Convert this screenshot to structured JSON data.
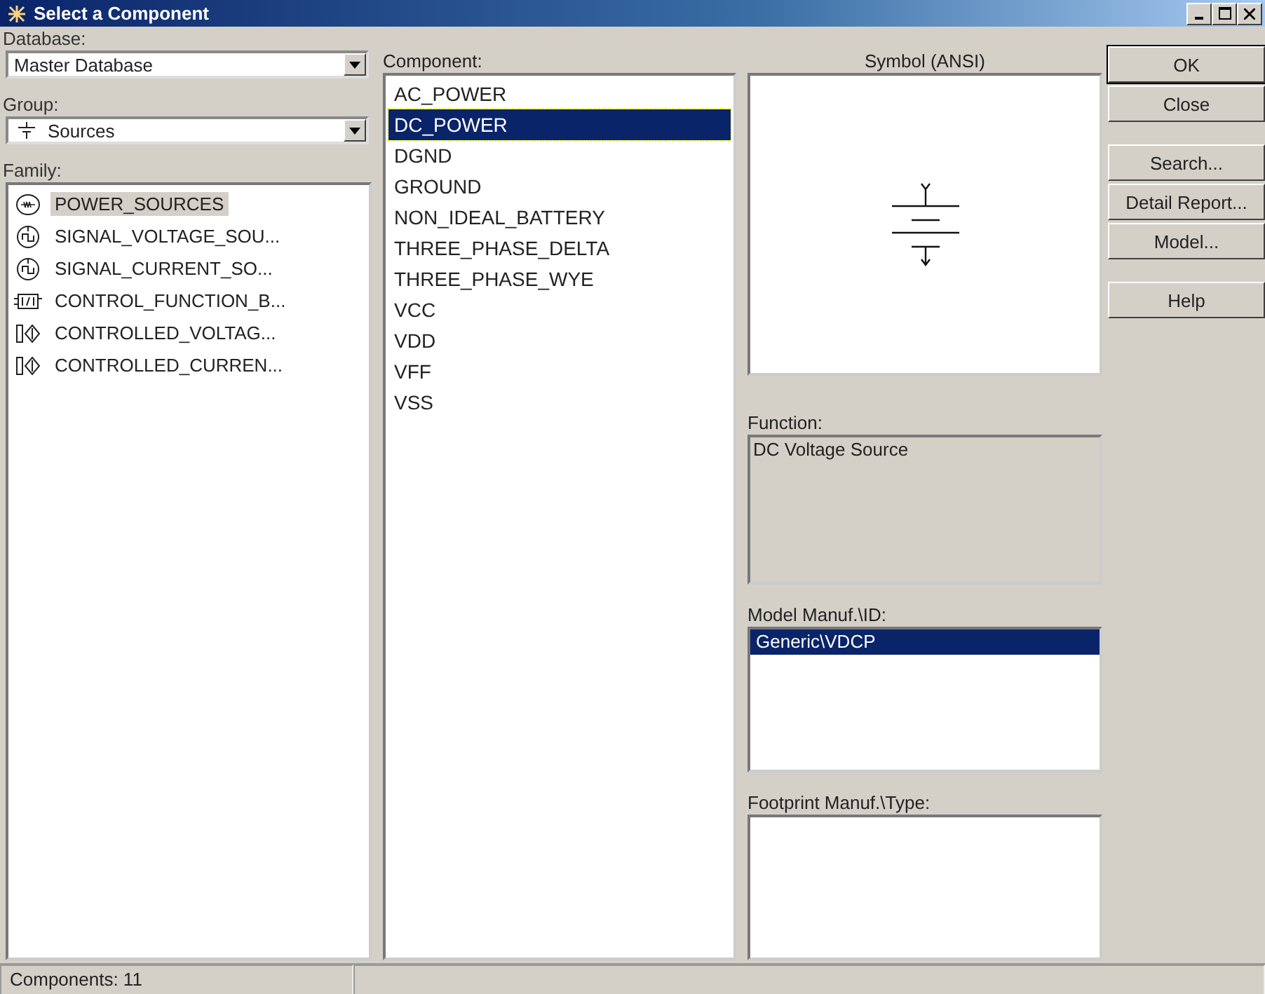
{
  "window": {
    "title": "Select a Component"
  },
  "database": {
    "label": "Database:",
    "value": "Master Database"
  },
  "group": {
    "label": "Group:",
    "value": "Sources"
  },
  "family": {
    "label": "Family:",
    "items": [
      {
        "label": "POWER_SOURCES",
        "selected": true
      },
      {
        "label": "SIGNAL_VOLTAGE_SOU...",
        "selected": false
      },
      {
        "label": "SIGNAL_CURRENT_SO...",
        "selected": false
      },
      {
        "label": "CONTROL_FUNCTION_B...",
        "selected": false
      },
      {
        "label": "CONTROLLED_VOLTAG...",
        "selected": false
      },
      {
        "label": "CONTROLLED_CURREN...",
        "selected": false
      }
    ]
  },
  "component": {
    "label": "Component:",
    "items": [
      {
        "label": "AC_POWER",
        "selected": false
      },
      {
        "label": "DC_POWER",
        "selected": true
      },
      {
        "label": "DGND",
        "selected": false
      },
      {
        "label": "GROUND",
        "selected": false
      },
      {
        "label": "NON_IDEAL_BATTERY",
        "selected": false
      },
      {
        "label": "THREE_PHASE_DELTA",
        "selected": false
      },
      {
        "label": "THREE_PHASE_WYE",
        "selected": false
      },
      {
        "label": "VCC",
        "selected": false
      },
      {
        "label": "VDD",
        "selected": false
      },
      {
        "label": "VFF",
        "selected": false
      },
      {
        "label": "VSS",
        "selected": false
      }
    ]
  },
  "symbol": {
    "label": "Symbol (ANSI)"
  },
  "function": {
    "label": "Function:",
    "value": "DC Voltage Source"
  },
  "model": {
    "label": "Model Manuf.\\ID:",
    "items": [
      {
        "label": "Generic\\VDCP",
        "selected": true
      }
    ]
  },
  "footprint": {
    "label": "Footprint Manuf.\\Type:"
  },
  "buttons": [
    {
      "label": "OK",
      "kind": "default"
    },
    {
      "label": "Close",
      "kind": "normal"
    },
    {
      "label": "Search...",
      "kind": "spaced"
    },
    {
      "label": "Detail Report...",
      "kind": "normal"
    },
    {
      "label": "Model...",
      "kind": "normal"
    },
    {
      "label": "Help",
      "kind": "spaced"
    }
  ],
  "status_bar": {
    "text": "Components: 11"
  }
}
